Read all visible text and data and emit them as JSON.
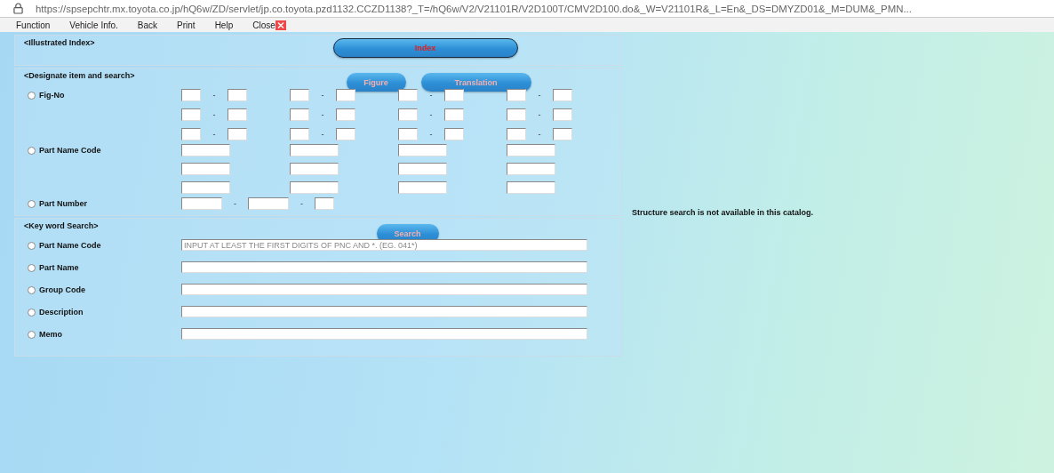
{
  "address_bar": {
    "url": "https://spsepchtr.mx.toyota.co.jp/hQ6w/ZD/servlet/jp.co.toyota.pzd1132.CCZD1138?_T=/hQ6w/V2/V21101R/V2D100T/CMV2D100.do&_W=V21101R&_L=En&_DS=DMYZD01&_M=DUM&_PMN..."
  },
  "menu": [
    {
      "label": "Function",
      "kind": "text"
    },
    {
      "label": "Vehicle Info.",
      "kind": "text"
    },
    {
      "label": "Back",
      "kind": "text"
    },
    {
      "label": "Print",
      "kind": "text"
    },
    {
      "label": "Help",
      "kind": "text"
    },
    {
      "label": "Close",
      "kind": "close"
    }
  ],
  "illustrated_index": {
    "heading": "<Illustrated Index>",
    "button": "Index"
  },
  "designate": {
    "heading": "<Designate item and search>",
    "buttons": [
      "Figure",
      "Translation"
    ],
    "fig_no": {
      "label": "Fig-No",
      "selected": false,
      "rows": [
        [
          "-",
          "-",
          "-",
          "-"
        ],
        [
          "-",
          "-",
          "-",
          "-"
        ],
        [
          "-",
          "-",
          "-",
          "-"
        ]
      ]
    },
    "part_name_code": {
      "label": "Part Name Code",
      "selected": false
    },
    "part_number": {
      "label": "Part Number",
      "selected": false,
      "separators": [
        "-",
        "-"
      ]
    }
  },
  "keyword_search": {
    "heading": "<Key word Search>",
    "button": "Search",
    "rows": [
      {
        "label": "Part Name Code",
        "selected": false,
        "placeholder": "INPUT AT LEAST THE FIRST DIGITS OF PNC AND *. (EG. 041*)"
      },
      {
        "label": "Part Name",
        "selected": false
      },
      {
        "label": "Group Code",
        "selected": false
      },
      {
        "label": "Description",
        "selected": false
      },
      {
        "label": "Memo",
        "selected": false
      }
    ]
  },
  "message": "Structure search is not available in this catalog."
}
